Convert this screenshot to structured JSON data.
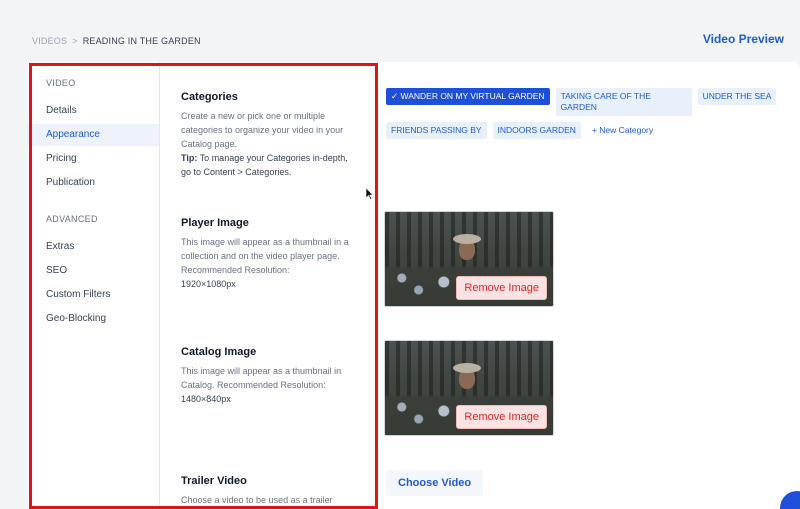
{
  "breadcrumb": {
    "parent": "VIDEOS",
    "separator": ">",
    "current": "READING IN THE GARDEN"
  },
  "header": {
    "preview_label": "Video Preview"
  },
  "sidebar": {
    "video_heading": "VIDEO",
    "video_items": [
      "Details",
      "Appearance",
      "Pricing",
      "Publication"
    ],
    "active_item": "Appearance",
    "advanced_heading": "ADVANCED",
    "advanced_items": [
      "Extras",
      "SEO",
      "Custom Filters",
      "Geo-Blocking"
    ]
  },
  "sections": {
    "categories": {
      "title": "Categories",
      "description": "Create a new or pick one or multiple categories to organize your video in your Catalog page.",
      "tip_label": "Tip:",
      "tip_text": " To manage your Categories in-depth, go to Content > Categories."
    },
    "player_image": {
      "title": "Player Image",
      "description": "This image will appear as a thumbnail in a collection and on the video player page. Recommended Resolution:",
      "resolution": "1920×1080px"
    },
    "catalog_image": {
      "title": "Catalog Image",
      "description": "This image will appear as a thumbnail in Catalog. Recommended Resolution:",
      "resolution": "1480×840px"
    },
    "trailer_video": {
      "title": "Trailer Video",
      "description": "Choose a video to be used as a trailer"
    }
  },
  "categories": {
    "selected_check": "✓",
    "tags": [
      {
        "label": "WANDER ON MY VIRTUAL GARDEN",
        "selected": true
      },
      {
        "label": "TAKING CARE OF THE GARDEN",
        "selected": false
      },
      {
        "label": "UNDER THE SEA",
        "selected": false
      },
      {
        "label": "FRIENDS PASSING BY",
        "selected": false
      },
      {
        "label": "INDOORS GARDEN",
        "selected": false
      }
    ],
    "new_category_label": "New Category",
    "new_category_icon": "+"
  },
  "buttons": {
    "remove_image": "Remove Image",
    "choose_video": "Choose Video"
  },
  "colors": {
    "accent": "#1e5bd6",
    "selected_tag": "#1e4fd8",
    "danger": "#dc2626",
    "highlight_box": "#e0131b"
  }
}
